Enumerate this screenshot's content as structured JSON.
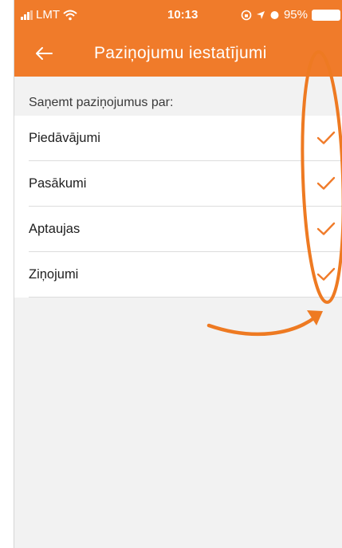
{
  "status_bar": {
    "carrier": "LMT",
    "time": "10:13",
    "battery": "95%"
  },
  "header": {
    "title": "Paziņojumu iestatījumi"
  },
  "section": {
    "label": "Saņemt paziņojumus par:"
  },
  "items": [
    {
      "label": "Piedāvājumi",
      "checked": true
    },
    {
      "label": "Pasākumi",
      "checked": true
    },
    {
      "label": "Aptaujas",
      "checked": true
    },
    {
      "label": "Ziņojumi",
      "checked": true
    }
  ],
  "colors": {
    "accent": "#f07b2a",
    "annotation": "#ee7a22"
  },
  "icons": {
    "back": "arrow-left-icon",
    "check": "checkmark-icon"
  }
}
